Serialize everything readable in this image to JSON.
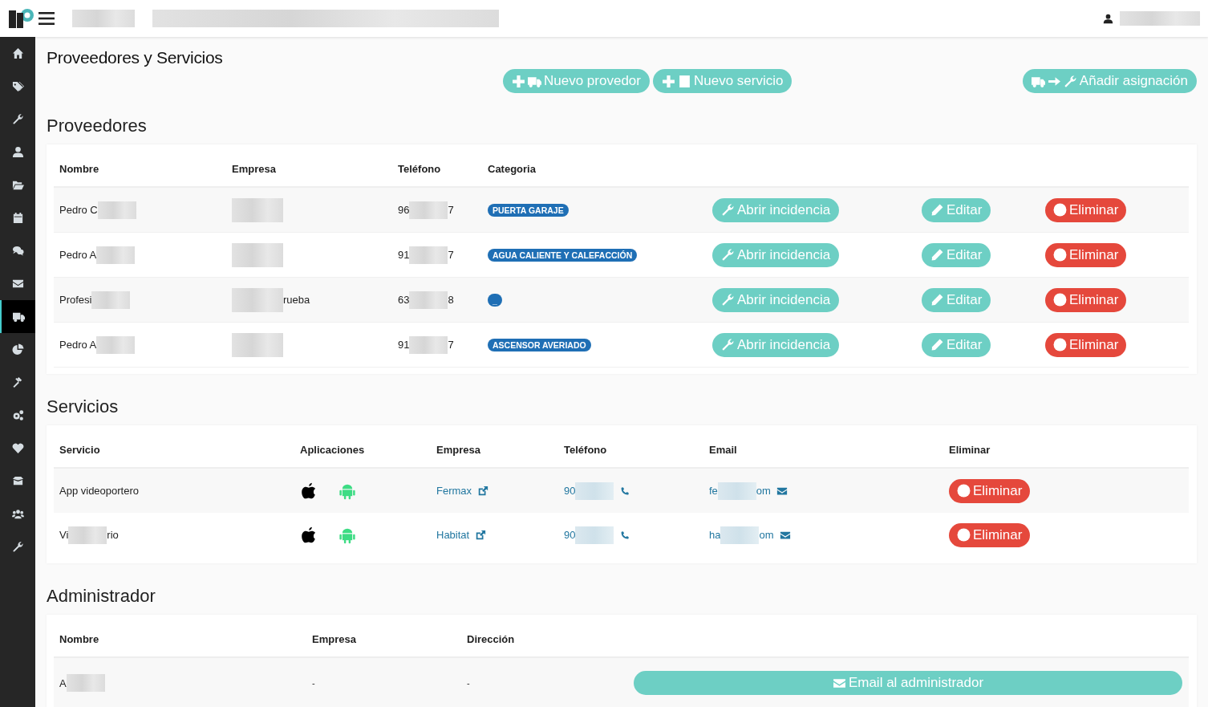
{
  "sidebar": {
    "items": [
      {
        "selected": false
      },
      {
        "selected": false
      },
      {
        "selected": false
      },
      {
        "selected": false
      },
      {
        "selected": false
      },
      {
        "selected": false
      },
      {
        "selected": false
      },
      {
        "selected": false
      },
      {
        "selected": true
      },
      {
        "selected": false
      },
      {
        "selected": false
      },
      {
        "selected": false
      },
      {
        "selected": false
      },
      {
        "selected": false
      },
      {
        "selected": false
      },
      {
        "selected": false
      }
    ]
  },
  "page_title": "Proveedores y Servicios",
  "actions": [
    {
      "label": "Nuevo provedor",
      "kind": "provider"
    },
    {
      "label": "Nuevo servicio",
      "kind": "service"
    },
    {
      "label": "Añadir asignación",
      "kind": "assignment"
    }
  ],
  "providers": {
    "heading": "Proveedores",
    "columns": [
      "Nombre",
      "Empresa",
      "Teléfono",
      "Categoria"
    ],
    "rows": [
      {
        "nombre": {
          "parts": [
            "Pedro C"
          ],
          "masked_end": true
        },
        "empresa": {
          "masked": true
        },
        "telefono": {
          "parts": [
            "96",
            "7"
          ]
        },
        "categoria": "PUERTA GARAJE",
        "open": "Abrir incidencia",
        "edit": "Editar",
        "delete": "Eliminar"
      },
      {
        "nombre": {
          "parts": [
            "Pedro A"
          ],
          "masked_end": true
        },
        "empresa": {
          "masked": true
        },
        "telefono": {
          "parts": [
            "91",
            "7"
          ]
        },
        "categoria": "AGUA CALIENTE Y CALEFACCIÓN",
        "open": "Abrir incidencia",
        "edit": "Editar",
        "delete": "Eliminar"
      },
      {
        "nombre": {
          "parts": [
            "Profesi"
          ],
          "masked_end": true
        },
        "empresa": {
          "masked_start": true,
          "parts": [
            "rueba"
          ]
        },
        "telefono": {
          "parts": [
            "63",
            "8"
          ]
        },
        "categoria": "_",
        "open": "Abrir incidencia",
        "edit": "Editar",
        "delete": "Eliminar"
      },
      {
        "nombre": {
          "parts": [
            "Pedro A"
          ],
          "masked_end": true
        },
        "empresa": {
          "masked": true
        },
        "telefono": {
          "parts": [
            "91",
            "7"
          ]
        },
        "categoria": "ASCENSOR AVERIADO",
        "open": "Abrir incidencia",
        "edit": "Editar",
        "delete": "Eliminar"
      }
    ]
  },
  "services": {
    "heading": "Servicios",
    "columns": [
      "Servicio",
      "Aplicaciones",
      "Empresa",
      "Teléfono",
      "Email",
      "Eliminar"
    ],
    "rows": [
      {
        "servicio": {
          "parts": [
            "App videoportero"
          ]
        },
        "empresa": "Fermax",
        "telefono": {
          "parts": [
            "90"
          ],
          "masked_end": true
        },
        "email": {
          "parts": [
            "fe",
            "om"
          ]
        },
        "delete": "Eliminar"
      },
      {
        "servicio": {
          "parts": [
            "Vi",
            "rio"
          ]
        },
        "empresa": "Habitat",
        "telefono": {
          "parts": [
            "90"
          ],
          "masked_end": true
        },
        "email": {
          "parts": [
            "ha",
            "om"
          ]
        },
        "delete": "Eliminar"
      }
    ]
  },
  "admin": {
    "heading": "Administrador",
    "columns": [
      "Nombre",
      "Empresa",
      "Dirección"
    ],
    "rows": [
      {
        "nombre": {
          "parts": [
            "A"
          ],
          "masked_end": true
        },
        "empresa": "-",
        "direccion": "-",
        "email_button": "Email al administrador"
      }
    ]
  }
}
